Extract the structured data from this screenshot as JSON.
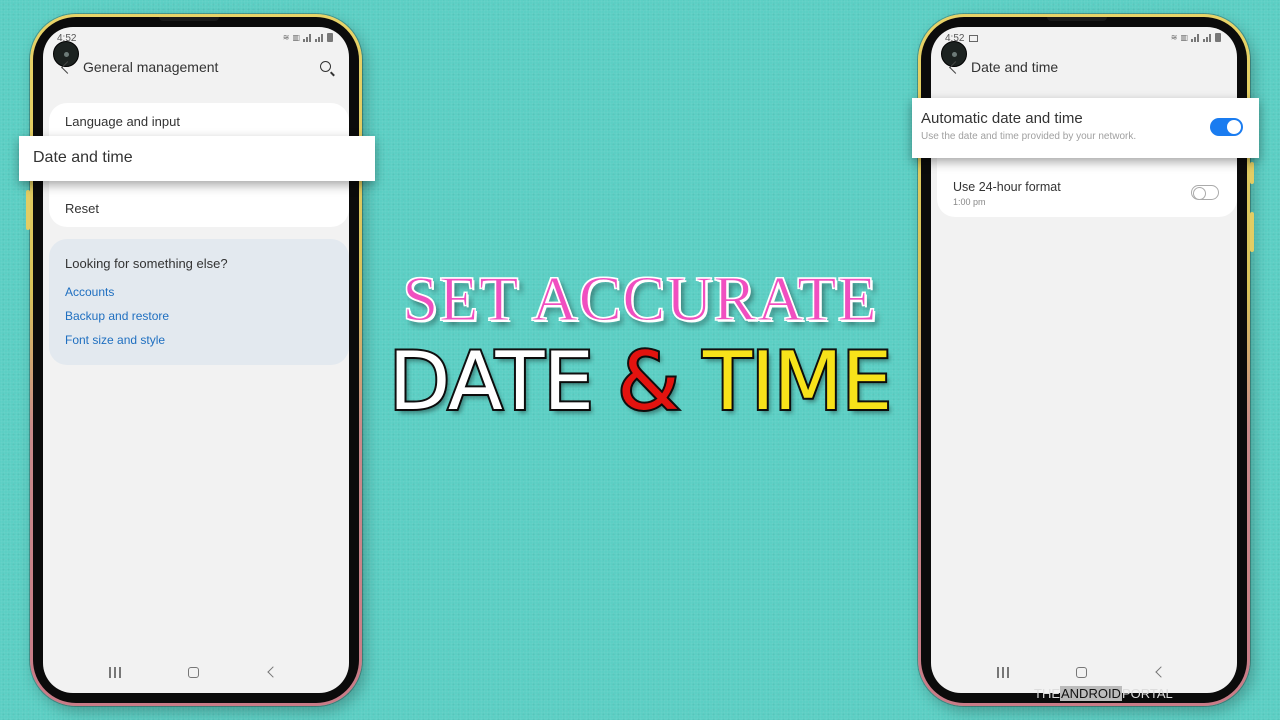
{
  "left_phone": {
    "status": {
      "time": "4:52"
    },
    "app_bar": {
      "title": "General management"
    },
    "items": [
      {
        "label": "Language and input"
      },
      {
        "label": "Date and time",
        "highlighted": true
      },
      {
        "label": "Reset"
      }
    ],
    "suggestions": {
      "heading": "Looking for something else?",
      "links": [
        "Accounts",
        "Backup and restore",
        "Font size and style"
      ]
    }
  },
  "headline": {
    "line1": "SET ACCURATE",
    "line2_word1": "DATE",
    "line2_amp": "&",
    "line2_word2": "TIME",
    "colors": {
      "line1": "#f04fc0",
      "date": "#ffffff",
      "amp": "#e3130f",
      "time": "#f7e21a"
    }
  },
  "right_phone": {
    "status": {
      "time": "4:52"
    },
    "app_bar": {
      "title": "Date and time"
    },
    "automatic": {
      "title": "Automatic date and time",
      "subtitle": "Use the date and time provided by your network.",
      "enabled": true,
      "highlighted": true
    },
    "hour24": {
      "title": "Use 24-hour format",
      "subtitle": "1:00 pm",
      "enabled": false
    }
  },
  "watermark": {
    "pre": "THE",
    "box": "ANDROID",
    "post": "PORTAL"
  },
  "colors": {
    "background": "#5ccfc4",
    "toggle_on": "#1a7cf0",
    "link": "#1f6fc0"
  }
}
